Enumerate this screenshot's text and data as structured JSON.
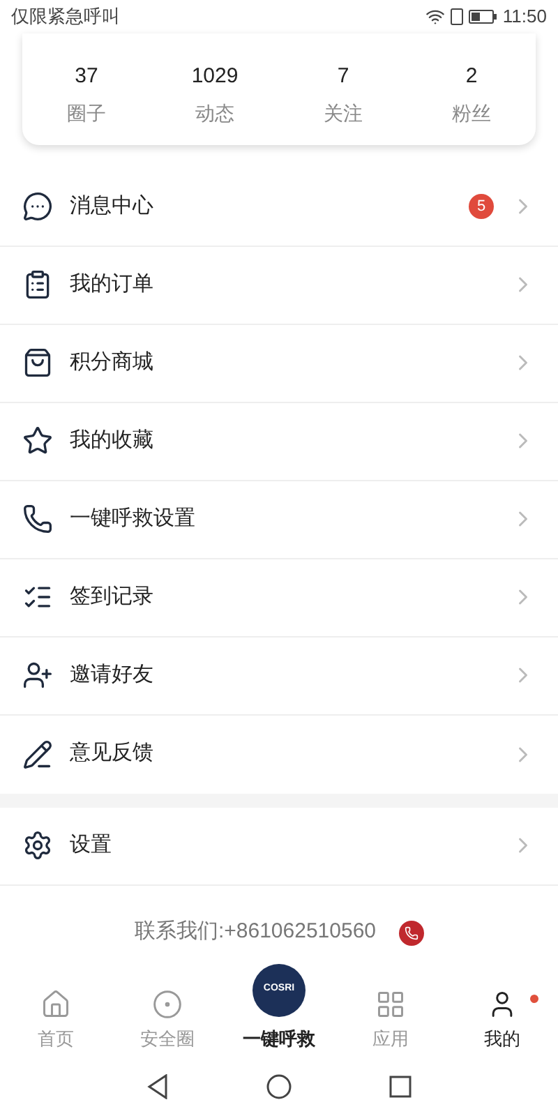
{
  "status_bar": {
    "carrier": "仅限紧急呼叫",
    "time": "11:50"
  },
  "stats": [
    {
      "value": "37",
      "label": "圈子"
    },
    {
      "value": "1029",
      "label": "动态"
    },
    {
      "value": "7",
      "label": "关注"
    },
    {
      "value": "2",
      "label": "粉丝"
    }
  ],
  "menu_groups": [
    [
      {
        "kind": "message",
        "label": "消息中心",
        "badge": "5"
      },
      {
        "kind": "orders",
        "label": "我的订单"
      },
      {
        "kind": "mall",
        "label": "积分商城"
      },
      {
        "kind": "favorites",
        "label": "我的收藏"
      },
      {
        "kind": "sos",
        "label": "一键呼救设置"
      },
      {
        "kind": "checkin",
        "label": "签到记录"
      },
      {
        "kind": "invite",
        "label": "邀请好友"
      },
      {
        "kind": "feedback",
        "label": "意见反馈"
      }
    ],
    [
      {
        "kind": "settings",
        "label": "设置"
      }
    ]
  ],
  "contact": {
    "text": "联系我们:+861062510560"
  },
  "tab_bar": [
    {
      "kind": "home",
      "label": "首页",
      "selected": false,
      "dot": false
    },
    {
      "kind": "circle",
      "label": "安全圈",
      "selected": false,
      "dot": false
    },
    {
      "kind": "sos",
      "label": "一键呼救",
      "selected": false,
      "dot": false,
      "logo_text": "COSRI"
    },
    {
      "kind": "apps",
      "label": "应用",
      "selected": false,
      "dot": false
    },
    {
      "kind": "me",
      "label": "我的",
      "selected": true,
      "dot": true
    }
  ]
}
